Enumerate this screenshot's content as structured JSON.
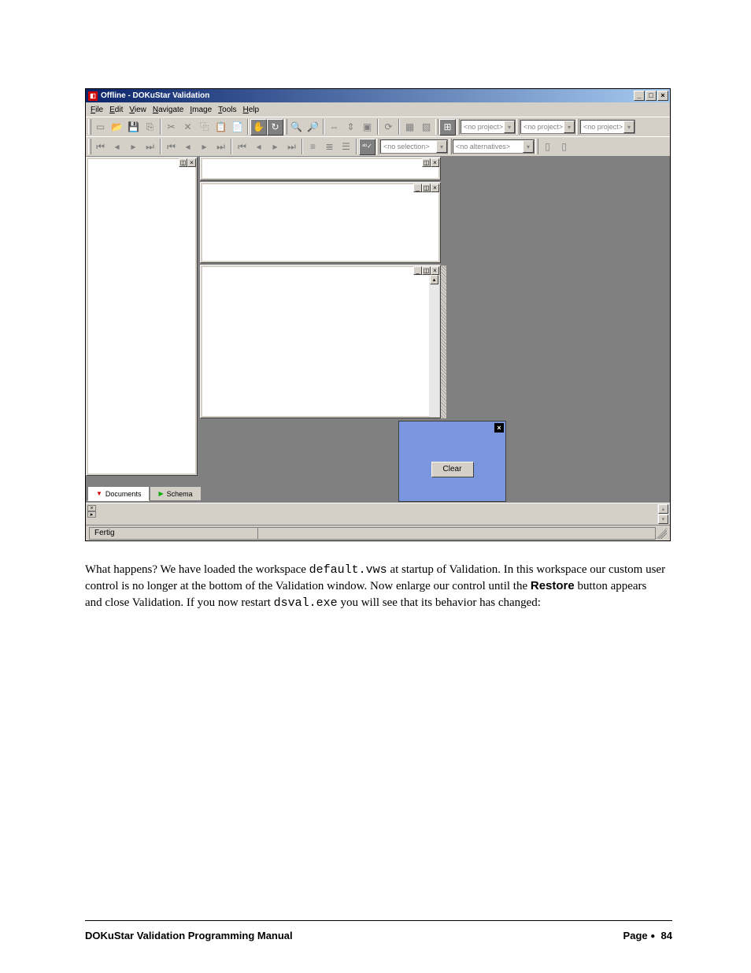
{
  "window": {
    "title": "Offline - DOKuStar Validation"
  },
  "menu": {
    "file": "File",
    "edit": "Edit",
    "view": "View",
    "navigate": "Navigate",
    "image": "Image",
    "tools": "Tools",
    "help": "Help"
  },
  "combos": {
    "project1": "<no project>",
    "project2": "<no project>",
    "project3": "<no project>",
    "selection": "<no selection>",
    "alternatives": "<no alternatives>"
  },
  "tabs": {
    "documents": "Documents",
    "schema": "Schema"
  },
  "buttons": {
    "clear": "Clear"
  },
  "status": {
    "text": "Fertig"
  },
  "body": {
    "p1a": "What happens? We have loaded  the workspace ",
    "p1code1": "default.vws",
    "p1b": "  at startup of Validation. In this workspace our custom user control is no longer at the bottom of the Validation window. Now enlarge our control until the ",
    "p1bold": "Restore",
    "p1c": " button appears and close Validation. If you now restart ",
    "p1code2": "dsval.exe",
    "p1d": " you will see that its behavior has changed:"
  },
  "footer": {
    "left": "DOKuStar Validation Programming Manual",
    "right_label": "Page",
    "right_num": "84"
  }
}
